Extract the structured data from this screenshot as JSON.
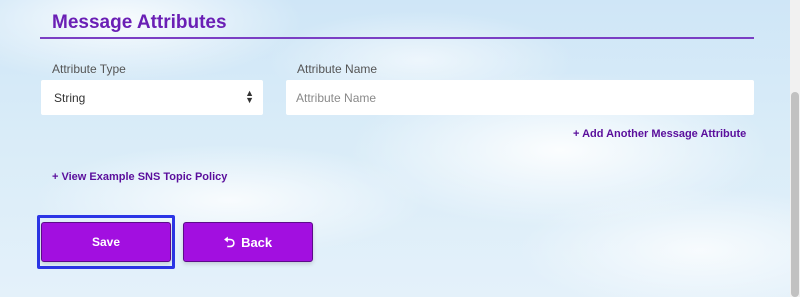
{
  "section": {
    "title": "Message Attributes"
  },
  "form": {
    "attribute_type_label": "Attribute Type",
    "attribute_type_value": "String",
    "attribute_name_label": "Attribute Name",
    "attribute_name_placeholder": "Attribute Name",
    "attribute_name_value": ""
  },
  "links": {
    "add_attribute": "+ Add Another Message Attribute",
    "view_policy": "+ View Example SNS Topic Policy"
  },
  "buttons": {
    "save_label": "Save",
    "back_label": "Back",
    "back_icon": "undo-arrow-icon"
  },
  "colors": {
    "accent": "#a20fe0",
    "title": "#6a1fb5",
    "link": "#5a0e9c",
    "focus": "#2b35e6"
  }
}
